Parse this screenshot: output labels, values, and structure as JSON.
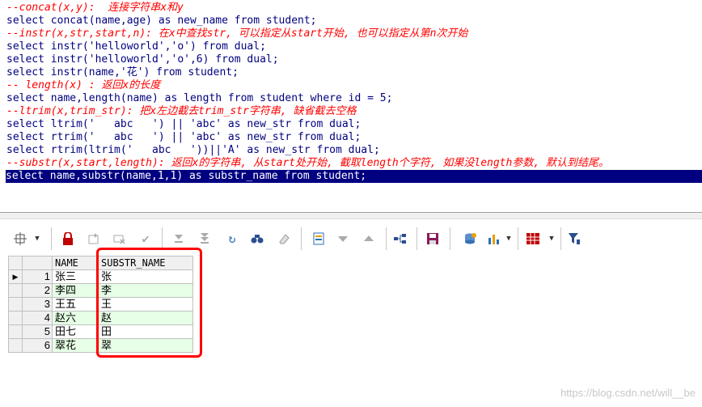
{
  "editor": {
    "lines": [
      {
        "text": "--concat(x,y):  连接字符串x和y",
        "kind": "comment"
      },
      {
        "text": "select concat(name,age) as new_name from student;",
        "kind": "code"
      },
      {
        "text": "--instr(x,str,start,n): 在x中查找str, 可以指定从start开始, 也可以指定从第n次开始",
        "kind": "comment"
      },
      {
        "text": "select instr('helloworld','o') from dual;",
        "kind": "code"
      },
      {
        "text": "select instr('helloworld','o',6) from dual;",
        "kind": "code"
      },
      {
        "text": "select instr(name,'花') from student;",
        "kind": "code"
      },
      {
        "text": "-- length(x) : 返回x的长度",
        "kind": "comment"
      },
      {
        "text": "select name,length(name) as length from student where id = 5;",
        "kind": "code"
      },
      {
        "text": "--ltrim(x,trim_str): 把x左边截去trim_str字符串, 缺省截去空格",
        "kind": "comment"
      },
      {
        "text": "select ltrim('   abc   ') || 'abc' as new_str from dual;",
        "kind": "code"
      },
      {
        "text": "select rtrim('   abc   ') || 'abc' as new_str from dual;",
        "kind": "code"
      },
      {
        "text": "select rtrim(ltrim('   abc   '))||'A' as new_str from dual;",
        "kind": "code"
      },
      {
        "text": "--substr(x,start,length): 返回x的字符串, 从start处开始, 截取length个字符, 如果没length参数, 默认到结尾。",
        "kind": "comment"
      },
      {
        "text": "select name,substr(name,1,1) as substr_name from student;",
        "kind": "selected"
      }
    ]
  },
  "toolbar": {
    "icons": [
      "grid-options-icon",
      "dropdown-arrow-icon",
      "lock-icon",
      "insert-record-icon",
      "delete-record-icon",
      "post-changes-icon",
      "next-page-icon",
      "last-page-icon",
      "refresh-icon",
      "find-icon",
      "clear-icon",
      "export-icon",
      "move-down-icon",
      "move-up-icon",
      "connect-icon",
      "save-icon",
      "fetch-icon",
      "chart-icon",
      "dropdown-arrow-icon",
      "table-view-icon",
      "dropdown-arrow-icon",
      "filter-icon"
    ]
  },
  "grid": {
    "columns": [
      "NAME",
      "SUBSTR_NAME"
    ],
    "rows": [
      {
        "num": "1",
        "name": "张三",
        "substr_name": "张"
      },
      {
        "num": "2",
        "name": "李四",
        "substr_name": "李"
      },
      {
        "num": "3",
        "name": "王五",
        "substr_name": "王"
      },
      {
        "num": "4",
        "name": "赵六",
        "substr_name": "赵"
      },
      {
        "num": "5",
        "name": "田七",
        "substr_name": "田"
      },
      {
        "num": "6",
        "name": "翠花",
        "substr_name": "翠"
      }
    ],
    "current_row_marker": "▶"
  },
  "watermark": "https://blog.csdn.net/will__be",
  "colors": {
    "keyword": "#000080",
    "comment": "#ff0000",
    "selection": "#000080",
    "alt_row": "#e6ffe6",
    "highlight": "#ff0000"
  }
}
